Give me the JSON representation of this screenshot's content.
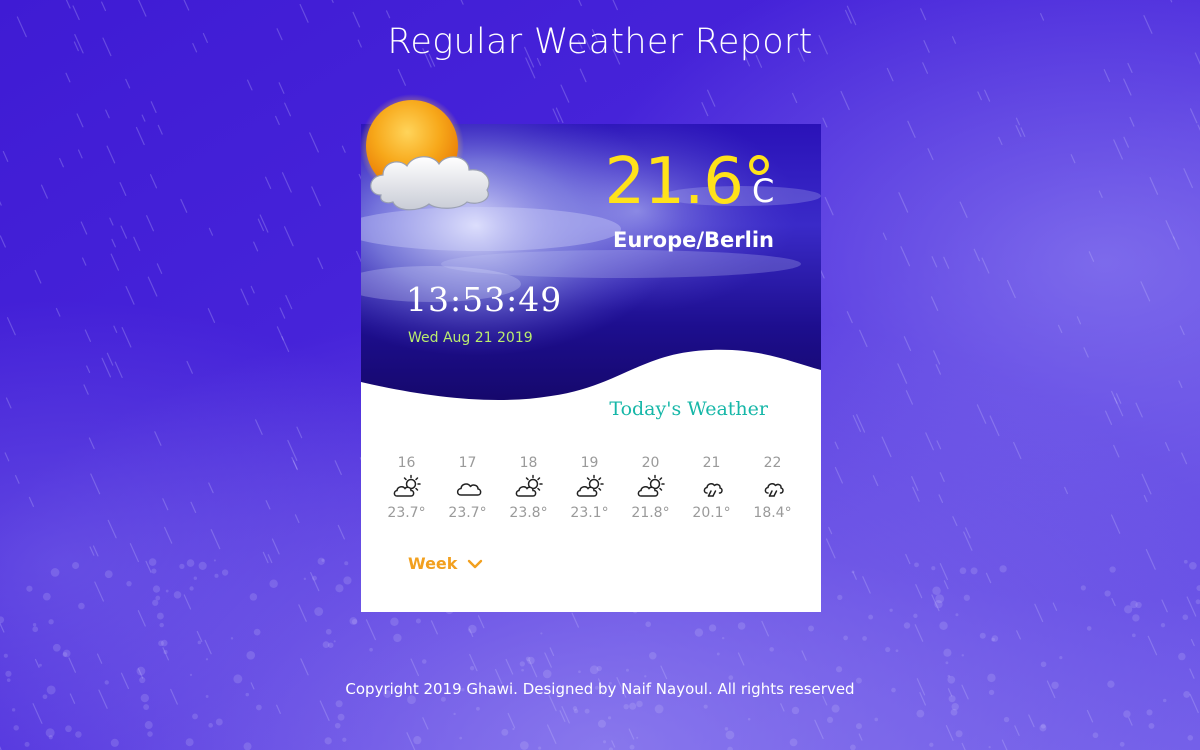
{
  "header": {
    "title": "Regular Weather Report"
  },
  "current": {
    "temperature": "21.6°",
    "unit": "C",
    "location": "Europe/Berlin",
    "time": "13:53:49",
    "date": "Wed Aug 21 2019",
    "icon": "sun-behind-cloud-icon"
  },
  "today_label": "Today's Weather",
  "forecast": [
    {
      "day": "16",
      "temp": "23.7°",
      "icon": "partly-sunny-icon"
    },
    {
      "day": "17",
      "temp": "23.7°",
      "icon": "cloud-icon"
    },
    {
      "day": "18",
      "temp": "23.8°",
      "icon": "partly-sunny-icon"
    },
    {
      "day": "19",
      "temp": "23.1°",
      "icon": "partly-sunny-icon"
    },
    {
      "day": "20",
      "temp": "21.8°",
      "icon": "partly-sunny-icon"
    },
    {
      "day": "21",
      "temp": "20.1°",
      "icon": "cloud-rain-icon"
    },
    {
      "day": "22",
      "temp": "18.4°",
      "icon": "cloud-rain-icon"
    }
  ],
  "week_toggle": {
    "label": "Week"
  },
  "footer": {
    "copyright": "Copyright 2019 Ghawi. Designed by Naif Nayoul. All rights reserved"
  },
  "colors": {
    "background": "#4a22d8",
    "temperature": "#ffe21a",
    "date": "#b9ec6e",
    "today_label": "#17b7a8",
    "week_toggle": "#f2a01f",
    "forecast_text": "#9a9a9a"
  }
}
